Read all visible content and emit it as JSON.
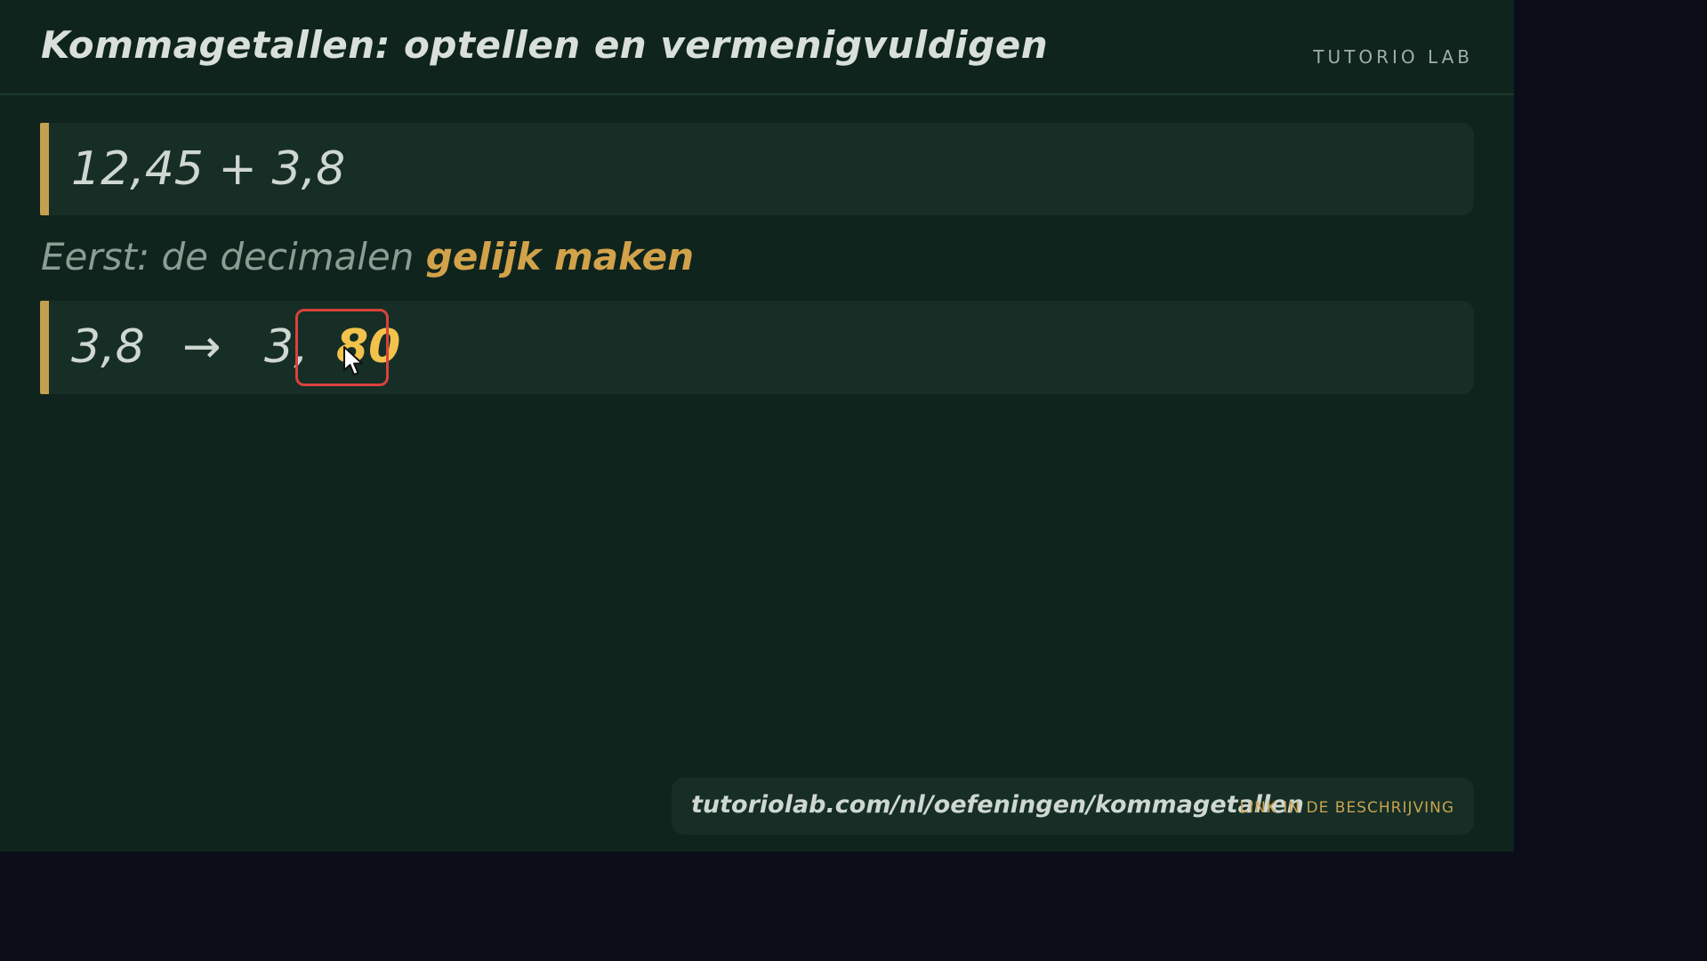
{
  "header": {
    "title": "Kommagetallen: optellen en vermenigvuldigen",
    "brand": "TUTORIO LAB"
  },
  "problem": {
    "expression": "12,45 + 3,8"
  },
  "step": {
    "prefix": "Eerst: de decimalen ",
    "highlight": "gelijk maken"
  },
  "transform": {
    "from": "3,8",
    "arrow": "→",
    "to_integer": "3,",
    "to_decimals": "80"
  },
  "footer": {
    "url": "tutoriolab.com/nl/oefeningen/kommagetallen",
    "note": "LINK IN DE BESCHRIJVING"
  },
  "colors": {
    "background": "#0f241d",
    "card": "#162e26",
    "accent_bar": "#c4a052",
    "highlight_text": "#d2a24a",
    "digits": "#f2c24c",
    "focus_border": "#d8433b"
  },
  "icons": {
    "cursor": "mouse-pointer-icon"
  }
}
